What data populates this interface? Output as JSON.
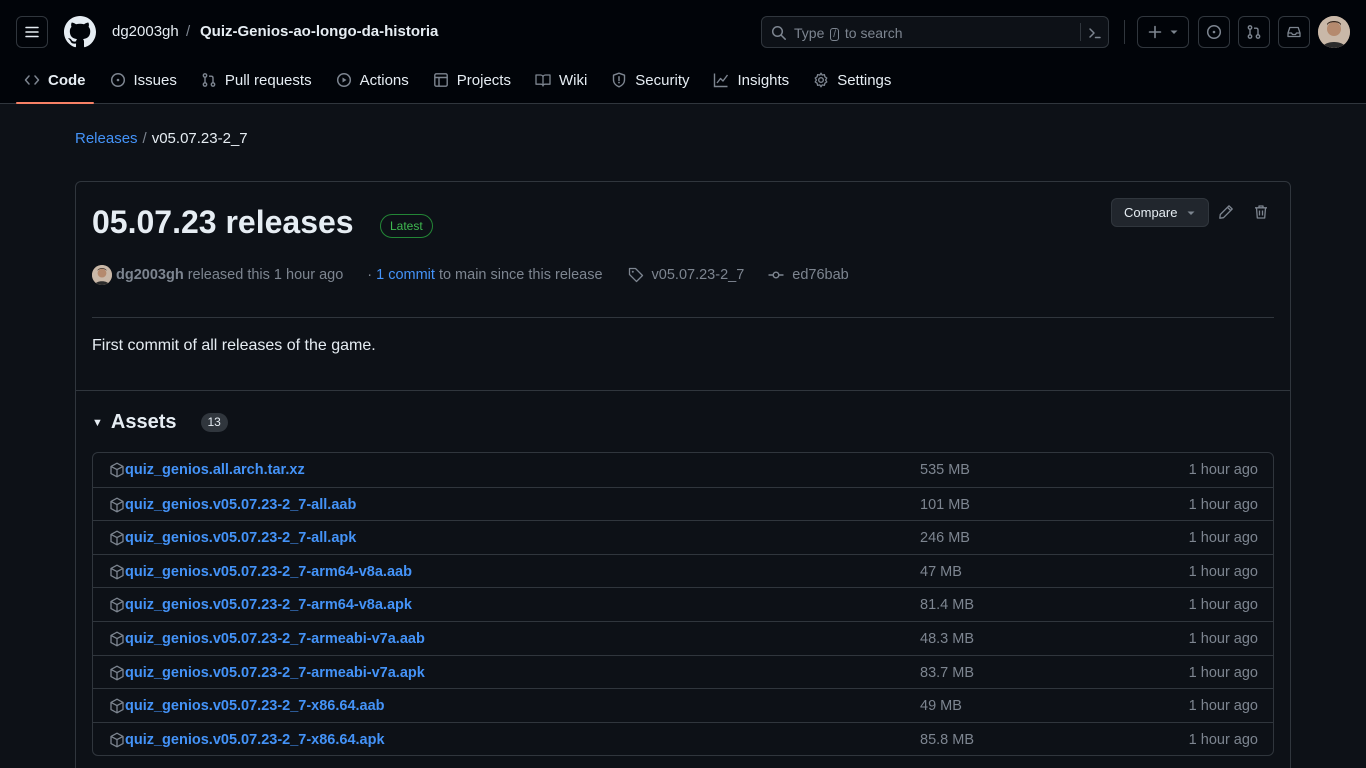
{
  "header": {
    "owner": "dg2003gh",
    "separator": "/",
    "repo": "Quiz-Genios-ao-longo-da-historia",
    "search": {
      "prefix": "Type",
      "key": "/",
      "suffix": "to search"
    }
  },
  "tabs": [
    {
      "label": "Code",
      "icon": "code-icon",
      "active": true
    },
    {
      "label": "Issues",
      "icon": "issue-icon"
    },
    {
      "label": "Pull requests",
      "icon": "pull-request-icon"
    },
    {
      "label": "Actions",
      "icon": "play-icon"
    },
    {
      "label": "Projects",
      "icon": "table-icon"
    },
    {
      "label": "Wiki",
      "icon": "book-icon"
    },
    {
      "label": "Security",
      "icon": "shield-icon"
    },
    {
      "label": "Insights",
      "icon": "graph-icon"
    },
    {
      "label": "Settings",
      "icon": "gear-icon"
    }
  ],
  "breadcrumb": {
    "link": "Releases",
    "separator": "/",
    "current": "v05.07.23-2_7"
  },
  "release": {
    "title": "05.07.23 releases",
    "badge": "Latest",
    "compare_label": "Compare",
    "author": "dg2003gh",
    "released_text": "released this 1 hour ago",
    "dot": "·",
    "commits_link": "1 commit",
    "commits_text": "to main since this release",
    "tag": "v05.07.23-2_7",
    "commit": "ed76bab",
    "description": "First commit of all releases of the game."
  },
  "assets": {
    "title": "Assets",
    "count": "13",
    "items": [
      {
        "name": "quiz_genios.all.arch.tar.xz",
        "size": "535 MB",
        "time": "1 hour ago"
      },
      {
        "name": "quiz_genios.v05.07.23-2_7-all.aab",
        "size": "101 MB",
        "time": "1 hour ago"
      },
      {
        "name": "quiz_genios.v05.07.23-2_7-all.apk",
        "size": "246 MB",
        "time": "1 hour ago"
      },
      {
        "name": "quiz_genios.v05.07.23-2_7-arm64-v8a.aab",
        "size": "47 MB",
        "time": "1 hour ago"
      },
      {
        "name": "quiz_genios.v05.07.23-2_7-arm64-v8a.apk",
        "size": "81.4 MB",
        "time": "1 hour ago"
      },
      {
        "name": "quiz_genios.v05.07.23-2_7-armeabi-v7a.aab",
        "size": "48.3 MB",
        "time": "1 hour ago"
      },
      {
        "name": "quiz_genios.v05.07.23-2_7-armeabi-v7a.apk",
        "size": "83.7 MB",
        "time": "1 hour ago"
      },
      {
        "name": "quiz_genios.v05.07.23-2_7-x86.64.aab",
        "size": "49 MB",
        "time": "1 hour ago"
      },
      {
        "name": "quiz_genios.v05.07.23-2_7-x86.64.apk",
        "size": "85.8 MB",
        "time": "1 hour ago"
      }
    ]
  },
  "colors": {
    "background": "#0d1117",
    "header": "#010409",
    "border": "#30363d",
    "link": "#4493f8",
    "muted": "#7d8590",
    "accent_underline": "#f78166",
    "latest": "#3fb950"
  }
}
